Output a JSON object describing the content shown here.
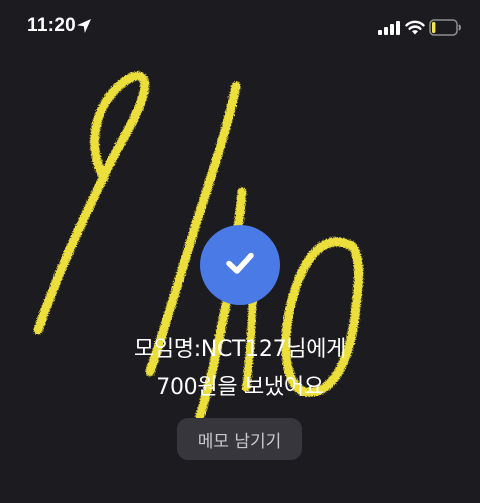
{
  "status_bar": {
    "time": "11:20",
    "icons": [
      "location-arrow-icon",
      "cellular-signal-icon",
      "wifi-icon",
      "battery-icon"
    ],
    "battery_level": 0.15,
    "battery_color": "#f1e35a"
  },
  "confirmation": {
    "icon": "checkmark-icon",
    "icon_bg_color": "#4a7ae6",
    "line1": "모임명:NCT127님에게",
    "line2": "700원을 보냈어요"
  },
  "memo_button": {
    "label": "메모 남기기"
  },
  "drawing": {
    "color": "#ecdf3a"
  }
}
